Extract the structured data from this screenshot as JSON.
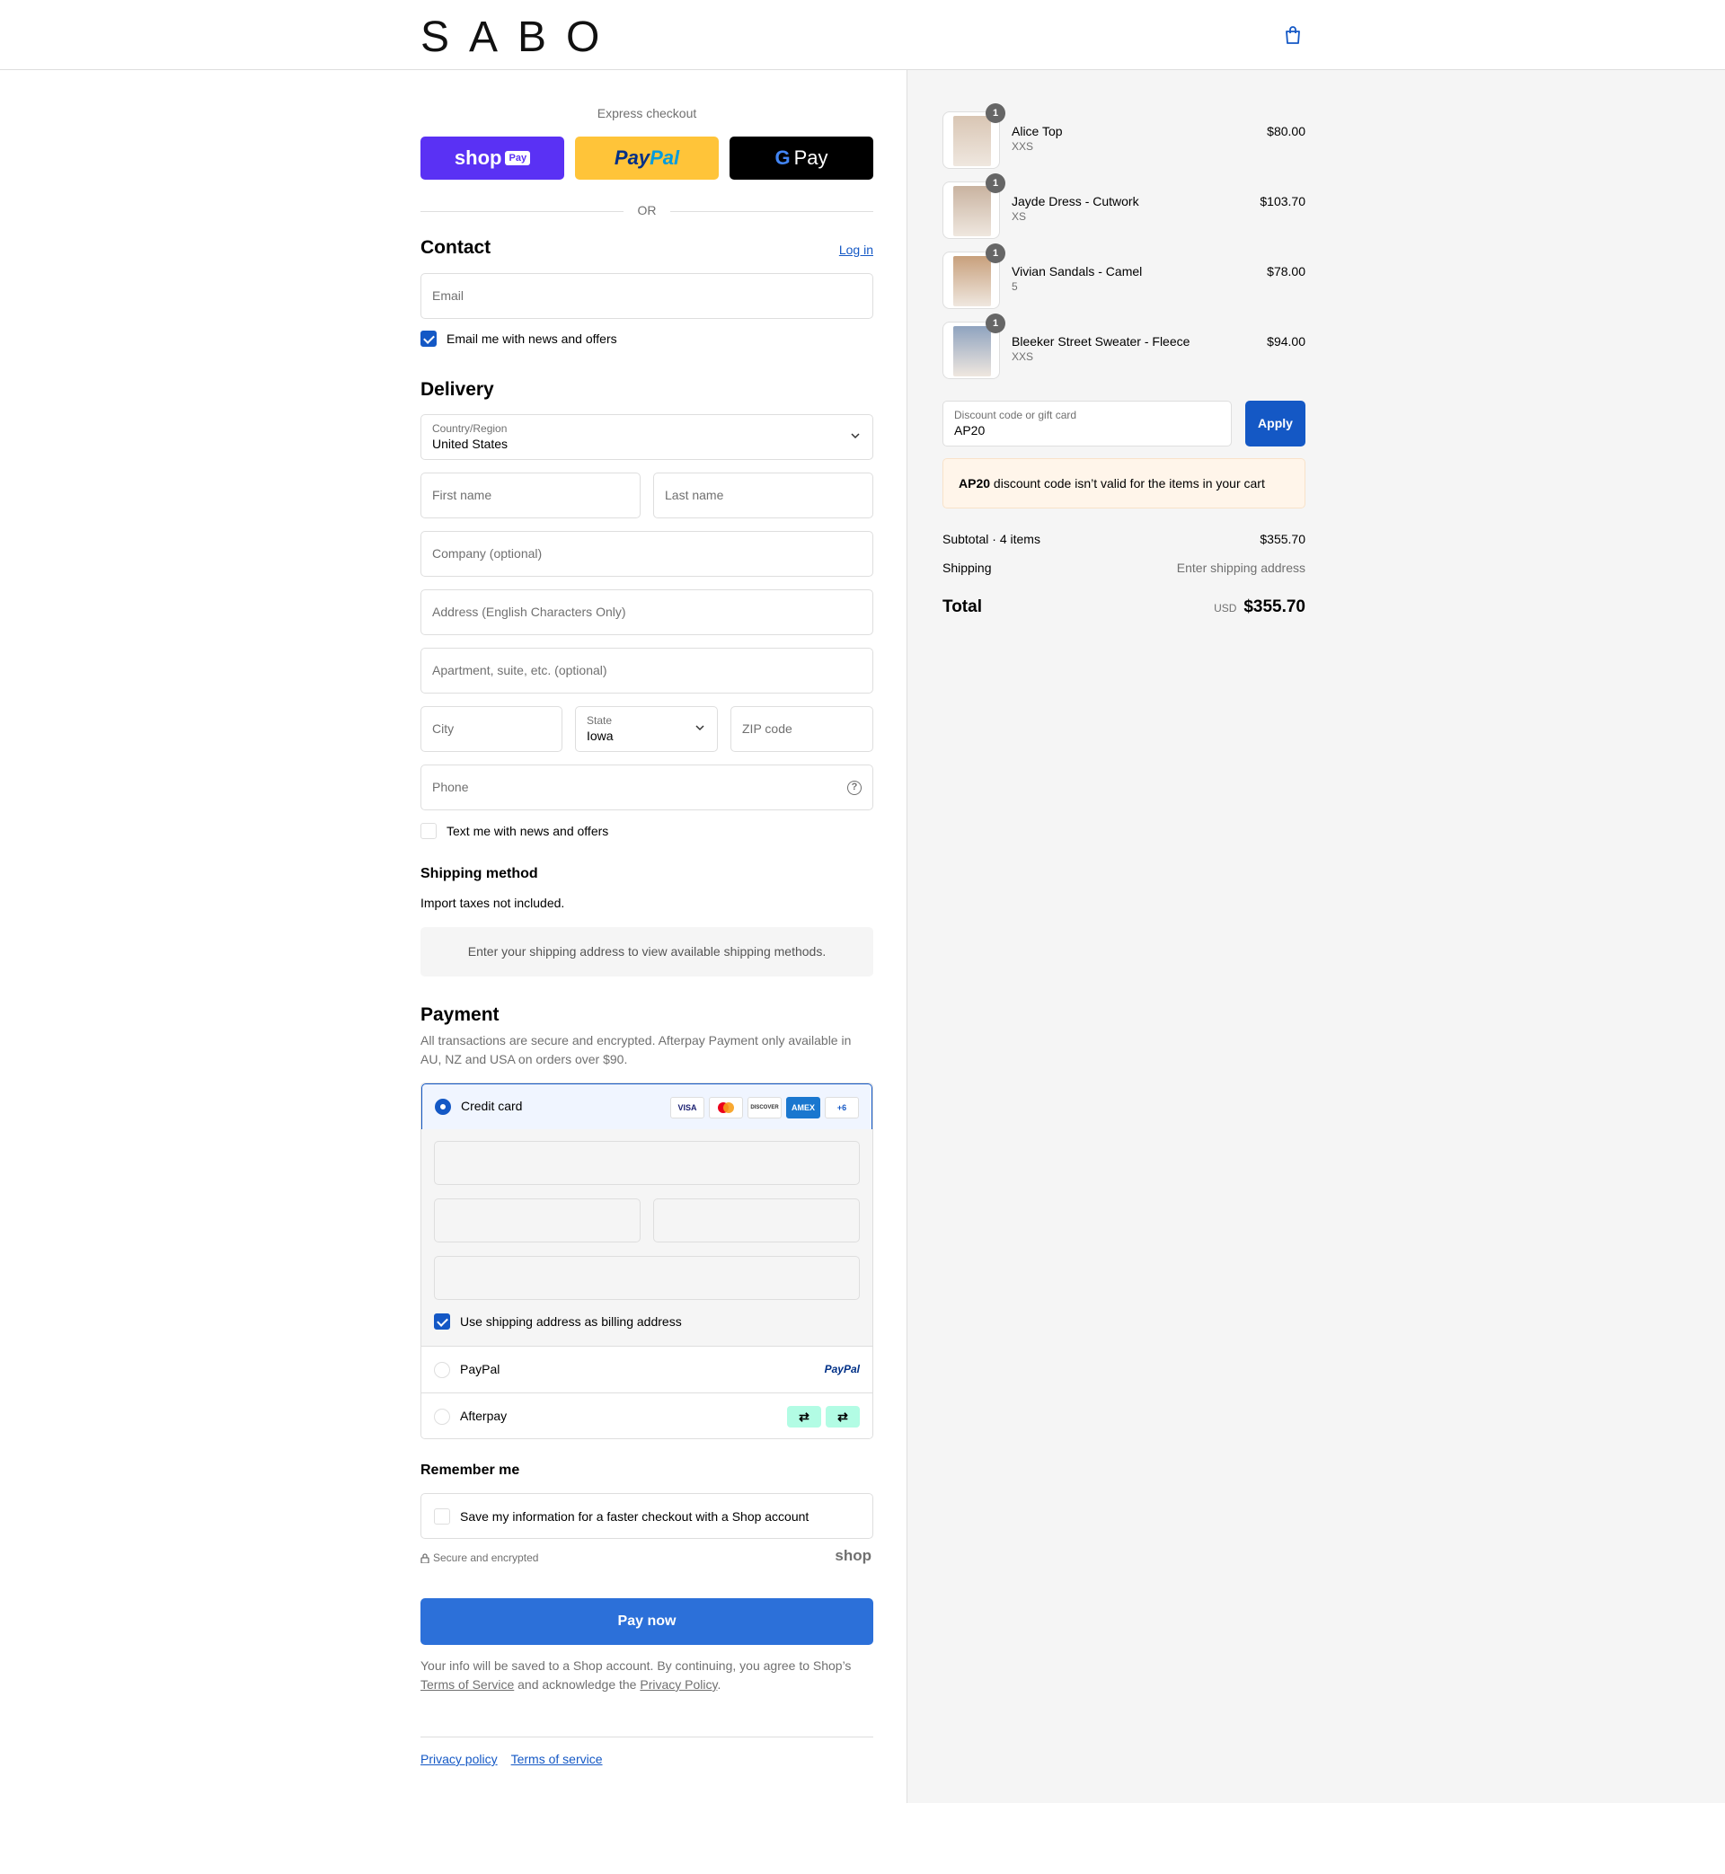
{
  "header": {
    "logo": "SABO",
    "cart_icon": "shopping-bag-icon"
  },
  "express": {
    "title": "Express checkout",
    "shop_pay": {
      "word": "shop",
      "badge": "Pay"
    },
    "paypal": {
      "part1": "Pay",
      "part2": "Pal"
    },
    "gpay": {
      "g": "G",
      "word": "Pay"
    },
    "or": "OR"
  },
  "contact": {
    "title": "Contact",
    "login": "Log in",
    "email_placeholder": "Email",
    "news_label": "Email me with news and offers"
  },
  "delivery": {
    "title": "Delivery",
    "country_label": "Country/Region",
    "country_value": "United States",
    "first_name": "First name",
    "last_name": "Last name",
    "company": "Company (optional)",
    "address": "Address (English Characters Only)",
    "apartment": "Apartment, suite, etc. (optional)",
    "city": "City",
    "state_label": "State",
    "state_value": "Iowa",
    "zip": "ZIP code",
    "phone": "Phone",
    "help": "?",
    "text_label": "Text me with news and offers"
  },
  "shipping": {
    "title": "Shipping method",
    "note": "Import taxes not included.",
    "info": "Enter your shipping address to view available shipping methods."
  },
  "payment": {
    "title": "Payment",
    "description": "All transactions are secure and encrypted. Afterpay Payment only available in AU, NZ and USA on orders over $90.",
    "credit_card": "Credit card",
    "cards": [
      {
        "name": "visa-icon",
        "text": "VISA",
        "color": "#1a1f71"
      },
      {
        "name": "mastercard-icon",
        "text": "",
        "color": "#eb001b"
      },
      {
        "name": "discover-icon",
        "text": "DISCOVER",
        "color": "#e9691e"
      },
      {
        "name": "amex-icon",
        "text": "AMEX",
        "color": "#1a77cf"
      },
      {
        "name": "more-cards-badge",
        "text": "+6",
        "color": "#1458c5"
      }
    ],
    "billing_label": "Use shipping address as billing address",
    "paypal": "PayPal",
    "paypal_logo": "PayPal",
    "afterpay": "Afterpay"
  },
  "remember": {
    "title": "Remember me",
    "label": "Save my information for a faster checkout with a Shop account",
    "secure": "Secure and encrypted",
    "shop_logo": "shop"
  },
  "pay_now": "Pay now",
  "legal": {
    "text1": "Your info will be saved to a Shop account. By continuing, you agree to Shop’s",
    "terms": "Terms of Service",
    "text2": "and acknowledge the",
    "privacy": "Privacy Policy",
    "end": "."
  },
  "footer": {
    "privacy": "Privacy policy",
    "terms": "Terms of service"
  },
  "cart": {
    "items": [
      {
        "name": "Alice Top",
        "variant": "XXS",
        "price": "$80.00",
        "qty": "1",
        "tone": "#d9c6b4"
      },
      {
        "name": "Jayde Dress - Cutwork",
        "variant": "XS",
        "price": "$103.70",
        "qty": "1",
        "tone": "#c9b3a0"
      },
      {
        "name": "Vivian Sandals - Camel",
        "variant": "5",
        "price": "$78.00",
        "qty": "1",
        "tone": "#c8a07c"
      },
      {
        "name": "Bleeker Street Sweater - Fleece",
        "variant": "XXS",
        "price": "$94.00",
        "qty": "1",
        "tone": "#8fa3bf"
      }
    ],
    "discount_label": "Discount code or gift card",
    "discount_value": "AP20",
    "apply": "Apply",
    "error_code": "AP20",
    "error_text": "discount code isn’t valid for the items in your cart",
    "subtotal_label": "Subtotal · 4 items",
    "subtotal_value": "$355.70",
    "shipping_label": "Shipping",
    "shipping_value": "Enter shipping address",
    "total_label": "Total",
    "currency": "USD",
    "total_value": "$355.70"
  },
  "colors": {
    "accent": "#1458c5",
    "pay_button": "#2c70d9",
    "shop_pay": "#5a31f4",
    "paypal": "#ffc439",
    "afterpay": "#b2fce4"
  }
}
